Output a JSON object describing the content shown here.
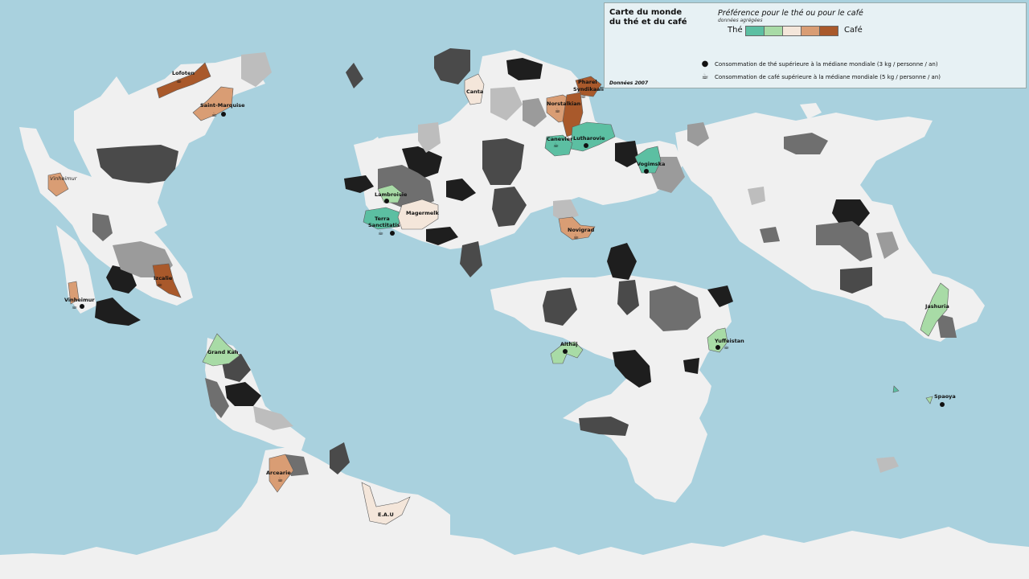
{
  "legend": {
    "title": "Carte du monde\ndu thé et du café",
    "year": "Données 2007",
    "scale_title": "Préférence pour le thé ou pour le café",
    "scale_subtitle": "données agrégées",
    "scale_left": "Thé",
    "scale_right": "Café",
    "scale_colors": [
      "#5cbfa2",
      "#a8dba6",
      "#f4e6da",
      "#d99d74",
      "#a9592b"
    ],
    "tea_icon": "teapot-icon",
    "tea_text": "Consommation de thé supérieure à la médiane mondiale (3 kg / personne / an)",
    "coffee_icon": "coffee-cup-icon",
    "coffee_text": "Consommation de café supérieure à la médiane mondiale (5 kg / personne / an)"
  },
  "colors": {
    "ocean": "#a9d1de",
    "land": "#f0f0f0",
    "no_data_shades": [
      "#1e1e1e",
      "#4a4a4a",
      "#6f6f6f",
      "#9b9b9b",
      "#bdbdbd"
    ]
  },
  "places": [
    {
      "name": "Lofoten",
      "pref": "coffee_strong",
      "tea": false,
      "coffee": true
    },
    {
      "name": "Saint-Marquise",
      "pref": "coffee_light",
      "tea": true,
      "coffee": true
    },
    {
      "name": "Vinheimur",
      "pref": "coffee_light",
      "tea": false,
      "coffee": false,
      "italic": true
    },
    {
      "name": "Vinheimur",
      "pref": "coffee_light",
      "tea": true,
      "coffee": true
    },
    {
      "name": "Izcalie",
      "pref": "coffee_strong",
      "tea": false,
      "coffee": true
    },
    {
      "name": "Grand Kah",
      "pref": "tea_light",
      "tea": false,
      "coffee": false
    },
    {
      "name": "Arcearie",
      "pref": "coffee_light",
      "tea": false,
      "coffee": true
    },
    {
      "name": "E.A.U",
      "pref": "neutral",
      "tea": false,
      "coffee": false
    },
    {
      "name": "Canta",
      "pref": "neutral",
      "tea": false,
      "coffee": false
    },
    {
      "name": "Pharel",
      "pref": "coffee_strong",
      "tea": false,
      "coffee": false
    },
    {
      "name": "Syndikaali",
      "pref": "coffee_strong",
      "tea": false,
      "coffee": true
    },
    {
      "name": "Norstalkian",
      "pref": "coffee_light",
      "tea": false,
      "coffee": true
    },
    {
      "name": "Lutharovie",
      "pref": "tea_strong",
      "tea": true,
      "coffee": false
    },
    {
      "name": "Canevier",
      "pref": "coffee_strong",
      "tea": false,
      "coffee": true
    },
    {
      "name": "Vogimska",
      "pref": "tea_light",
      "tea": true,
      "coffee": false
    },
    {
      "name": "Lambroisie",
      "pref": "tea_light",
      "tea": true,
      "coffee": false
    },
    {
      "name": "Terra",
      "pref": "tea_strong",
      "tea": false,
      "coffee": false
    },
    {
      "name": "Sanctitatis",
      "pref": "tea_strong",
      "tea": true,
      "coffee": true
    },
    {
      "name": "Magermelk",
      "pref": "neutral",
      "tea": false,
      "coffee": false
    },
    {
      "name": "Novigrad",
      "pref": "coffee_light",
      "tea": false,
      "coffee": true
    },
    {
      "name": "Althaj",
      "pref": "tea_light",
      "tea": true,
      "coffee": false
    },
    {
      "name": "Yuffeistan",
      "pref": "tea_light",
      "tea": true,
      "coffee": true
    },
    {
      "name": "Jashuria",
      "pref": "tea_light",
      "tea": false,
      "coffee": false
    },
    {
      "name": "Spaoya",
      "pref": "tea_strong",
      "tea": true,
      "coffee": false
    }
  ]
}
